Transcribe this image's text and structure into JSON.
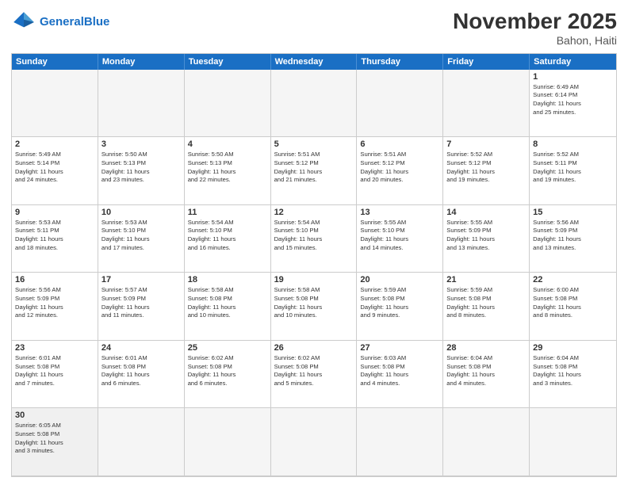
{
  "header": {
    "logo_general": "General",
    "logo_blue": "Blue",
    "month_title": "November 2025",
    "location": "Bahon, Haiti"
  },
  "days_of_week": [
    "Sunday",
    "Monday",
    "Tuesday",
    "Wednesday",
    "Thursday",
    "Friday",
    "Saturday"
  ],
  "cells": [
    {
      "day": "",
      "info": "",
      "empty": true
    },
    {
      "day": "",
      "info": "",
      "empty": true
    },
    {
      "day": "",
      "info": "",
      "empty": true
    },
    {
      "day": "",
      "info": "",
      "empty": true
    },
    {
      "day": "",
      "info": "",
      "empty": true
    },
    {
      "day": "",
      "info": "",
      "empty": true
    },
    {
      "day": "1",
      "info": "Sunrise: 6:49 AM\nSunset: 6:14 PM\nDaylight: 11 hours\nand 25 minutes."
    },
    {
      "day": "2",
      "info": "Sunrise: 5:49 AM\nSunset: 5:14 PM\nDaylight: 11 hours\nand 24 minutes."
    },
    {
      "day": "3",
      "info": "Sunrise: 5:50 AM\nSunset: 5:13 PM\nDaylight: 11 hours\nand 23 minutes."
    },
    {
      "day": "4",
      "info": "Sunrise: 5:50 AM\nSunset: 5:13 PM\nDaylight: 11 hours\nand 22 minutes."
    },
    {
      "day": "5",
      "info": "Sunrise: 5:51 AM\nSunset: 5:12 PM\nDaylight: 11 hours\nand 21 minutes."
    },
    {
      "day": "6",
      "info": "Sunrise: 5:51 AM\nSunset: 5:12 PM\nDaylight: 11 hours\nand 20 minutes."
    },
    {
      "day": "7",
      "info": "Sunrise: 5:52 AM\nSunset: 5:12 PM\nDaylight: 11 hours\nand 19 minutes."
    },
    {
      "day": "8",
      "info": "Sunrise: 5:52 AM\nSunset: 5:11 PM\nDaylight: 11 hours\nand 19 minutes."
    },
    {
      "day": "9",
      "info": "Sunrise: 5:53 AM\nSunset: 5:11 PM\nDaylight: 11 hours\nand 18 minutes."
    },
    {
      "day": "10",
      "info": "Sunrise: 5:53 AM\nSunset: 5:10 PM\nDaylight: 11 hours\nand 17 minutes."
    },
    {
      "day": "11",
      "info": "Sunrise: 5:54 AM\nSunset: 5:10 PM\nDaylight: 11 hours\nand 16 minutes."
    },
    {
      "day": "12",
      "info": "Sunrise: 5:54 AM\nSunset: 5:10 PM\nDaylight: 11 hours\nand 15 minutes."
    },
    {
      "day": "13",
      "info": "Sunrise: 5:55 AM\nSunset: 5:10 PM\nDaylight: 11 hours\nand 14 minutes."
    },
    {
      "day": "14",
      "info": "Sunrise: 5:55 AM\nSunset: 5:09 PM\nDaylight: 11 hours\nand 13 minutes."
    },
    {
      "day": "15",
      "info": "Sunrise: 5:56 AM\nSunset: 5:09 PM\nDaylight: 11 hours\nand 13 minutes."
    },
    {
      "day": "16",
      "info": "Sunrise: 5:56 AM\nSunset: 5:09 PM\nDaylight: 11 hours\nand 12 minutes."
    },
    {
      "day": "17",
      "info": "Sunrise: 5:57 AM\nSunset: 5:09 PM\nDaylight: 11 hours\nand 11 minutes."
    },
    {
      "day": "18",
      "info": "Sunrise: 5:58 AM\nSunset: 5:08 PM\nDaylight: 11 hours\nand 10 minutes."
    },
    {
      "day": "19",
      "info": "Sunrise: 5:58 AM\nSunset: 5:08 PM\nDaylight: 11 hours\nand 10 minutes."
    },
    {
      "day": "20",
      "info": "Sunrise: 5:59 AM\nSunset: 5:08 PM\nDaylight: 11 hours\nand 9 minutes."
    },
    {
      "day": "21",
      "info": "Sunrise: 5:59 AM\nSunset: 5:08 PM\nDaylight: 11 hours\nand 8 minutes."
    },
    {
      "day": "22",
      "info": "Sunrise: 6:00 AM\nSunset: 5:08 PM\nDaylight: 11 hours\nand 8 minutes."
    },
    {
      "day": "23",
      "info": "Sunrise: 6:01 AM\nSunset: 5:08 PM\nDaylight: 11 hours\nand 7 minutes."
    },
    {
      "day": "24",
      "info": "Sunrise: 6:01 AM\nSunset: 5:08 PM\nDaylight: 11 hours\nand 6 minutes."
    },
    {
      "day": "25",
      "info": "Sunrise: 6:02 AM\nSunset: 5:08 PM\nDaylight: 11 hours\nand 6 minutes."
    },
    {
      "day": "26",
      "info": "Sunrise: 6:02 AM\nSunset: 5:08 PM\nDaylight: 11 hours\nand 5 minutes."
    },
    {
      "day": "27",
      "info": "Sunrise: 6:03 AM\nSunset: 5:08 PM\nDaylight: 11 hours\nand 4 minutes."
    },
    {
      "day": "28",
      "info": "Sunrise: 6:04 AM\nSunset: 5:08 PM\nDaylight: 11 hours\nand 4 minutes."
    },
    {
      "day": "29",
      "info": "Sunrise: 6:04 AM\nSunset: 5:08 PM\nDaylight: 11 hours\nand 3 minutes."
    },
    {
      "day": "30",
      "info": "Sunrise: 6:05 AM\nSunset: 5:08 PM\nDaylight: 11 hours\nand 3 minutes."
    },
    {
      "day": "",
      "info": "",
      "empty": true
    },
    {
      "day": "",
      "info": "",
      "empty": true
    },
    {
      "day": "",
      "info": "",
      "empty": true
    },
    {
      "day": "",
      "info": "",
      "empty": true
    },
    {
      "day": "",
      "info": "",
      "empty": true
    },
    {
      "day": "",
      "info": "",
      "empty": true
    }
  ]
}
